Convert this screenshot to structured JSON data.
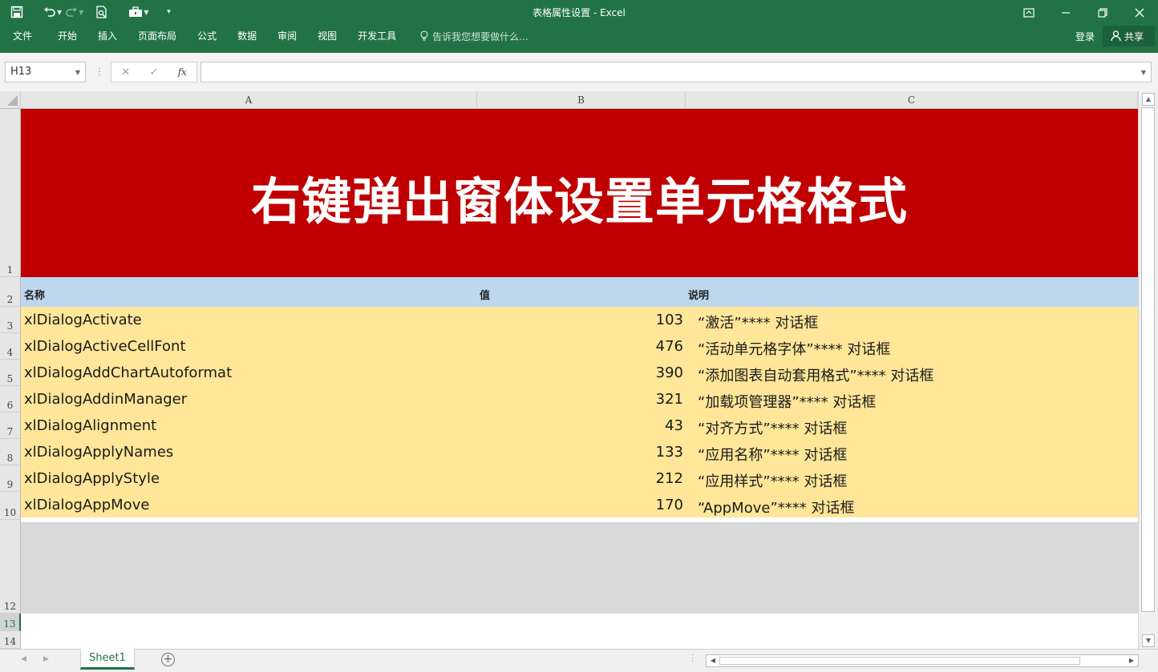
{
  "window": {
    "title": "表格属性设置 - Excel"
  },
  "ribbon": {
    "tabs": [
      "文件",
      "开始",
      "插入",
      "页面布局",
      "公式",
      "数据",
      "审阅",
      "视图",
      "开发工具"
    ],
    "tell_me": "告诉我您想要做什么...",
    "login": "登录",
    "share": "共享"
  },
  "formula_bar": {
    "name_box": "H13",
    "fx_label": "fx",
    "formula": ""
  },
  "columns": [
    "A",
    "B",
    "C"
  ],
  "row_numbers": [
    "1",
    "2",
    "3",
    "4",
    "5",
    "6",
    "7",
    "8",
    "9",
    "10",
    "12",
    "13",
    "14"
  ],
  "sheet": {
    "title": "右键弹出窗体设置单元格格式",
    "headers": {
      "name": "名称",
      "value": "值",
      "desc": "说明"
    },
    "rows": [
      {
        "name": "xlDialogActivate",
        "value": "103",
        "desc": "“激活”**** 对话框"
      },
      {
        "name": "xlDialogActiveCellFont",
        "value": "476",
        "desc": "“活动单元格字体”**** 对话框"
      },
      {
        "name": "xlDialogAddChartAutoformat",
        "value": "390",
        "desc": "“添加图表自动套用格式”**** 对话框"
      },
      {
        "name": "xlDialogAddinManager",
        "value": "321",
        "desc": "“加载项管理器”**** 对话框"
      },
      {
        "name": "xlDialogAlignment",
        "value": "43",
        "desc": "“对齐方式”**** 对话框"
      },
      {
        "name": "xlDialogApplyNames",
        "value": "133",
        "desc": "“应用名称”**** 对话框"
      },
      {
        "name": "xlDialogApplyStyle",
        "value": "212",
        "desc": "“应用样式”**** 对话框"
      },
      {
        "name": "xlDialogAppMove",
        "value": "170",
        "desc": "“AppMove”**** 对话框"
      }
    ]
  },
  "sheet_tabs": [
    "Sheet1"
  ],
  "colors": {
    "excel_green": "#217346",
    "title_red": "#c00000",
    "header_blue": "#bdd7ee",
    "data_yellow": "#ffe699",
    "grey_block": "#d9d9d9"
  }
}
